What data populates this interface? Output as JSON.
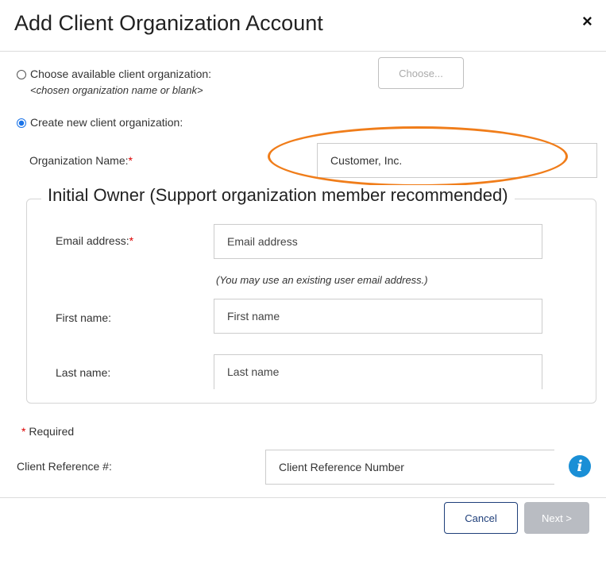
{
  "dialog": {
    "title": "Add Client Organization Account",
    "close_symbol": "×"
  },
  "choose_option": {
    "label": "Choose available client organization:",
    "sublabel": "<chosen organization name or blank>",
    "button_label": "Choose..."
  },
  "create_option": {
    "label": "Create new client organization:"
  },
  "org_name": {
    "label": "Organization Name:",
    "required_mark": "*",
    "value": "Customer, Inc."
  },
  "owner": {
    "legend": "Initial Owner (Support organization member recommended)",
    "email_label": "Email address:",
    "email_required_mark": "*",
    "email_placeholder": "Email address",
    "email_hint": "(You may use an existing user email address.)",
    "first_label": "First name:",
    "first_placeholder": "First name",
    "last_label": "Last name:",
    "last_placeholder": "Last name"
  },
  "required_note": {
    "mark": "*",
    "text": "Required"
  },
  "client_ref": {
    "label": "Client Reference #:",
    "placeholder": "Client Reference Number",
    "info_icon": "i"
  },
  "footer": {
    "cancel_label": "Cancel",
    "next_label": "Next >"
  },
  "colors": {
    "accent_blue": "#1a73e8",
    "annotation_orange": "#f07d1a",
    "required_red": "#dd0000",
    "disabled_gray": "#b9bcc2"
  }
}
